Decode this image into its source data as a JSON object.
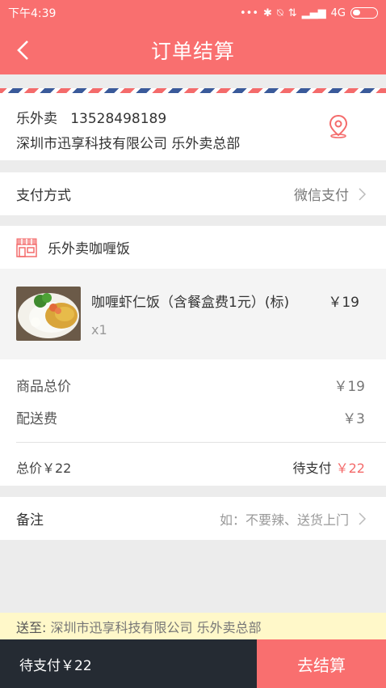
{
  "status_bar": {
    "time": "下午4:39",
    "network": "4G"
  },
  "header": {
    "title": "订单结算"
  },
  "address": {
    "name": "乐外卖",
    "phone": "13528498189",
    "detail": "深圳市迅享科技有限公司  乐外卖总部"
  },
  "payment": {
    "label": "支付方式",
    "value": "微信支付"
  },
  "shop": {
    "name": "乐外卖咖喱饭"
  },
  "order_items": [
    {
      "name": "咖喱虾仁饭（含餐盒费1元）(标)",
      "price": "￥19",
      "qty": "x1"
    }
  ],
  "summary": {
    "goods_label": "商品总价",
    "goods_value": "￥19",
    "delivery_label": "配送费",
    "delivery_value": "￥3",
    "total_label": "总价￥22",
    "pending_label": "待支付",
    "pending_value": "￥22"
  },
  "remark": {
    "label": "备注",
    "placeholder": "如：不要辣、送货上门"
  },
  "deliver_to": {
    "label": "送至:",
    "address": "深圳市迅享科技有限公司  乐外卖总部"
  },
  "footer": {
    "pending": "待支付￥22",
    "checkout": "去结算"
  },
  "colors": {
    "brand": "#f96f6f",
    "dark": "#252b33",
    "notice_bg": "#fff8c9"
  }
}
